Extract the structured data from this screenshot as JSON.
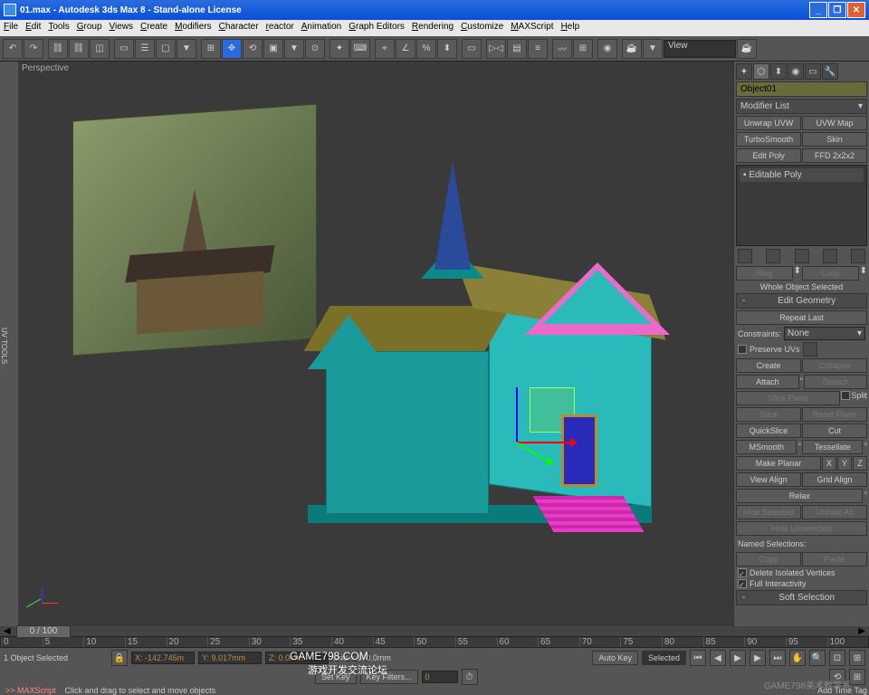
{
  "window": {
    "title": "01.max - Autodesk 3ds Max 8 - Stand-alone License"
  },
  "menu": [
    "File",
    "Edit",
    "Tools",
    "Group",
    "Views",
    "Create",
    "Modifiers",
    "Character",
    "reactor",
    "Animation",
    "Graph Editors",
    "Rendering",
    "Customize",
    "MAXScript",
    "Help"
  ],
  "toolbar": {
    "view_label": "View"
  },
  "leftstrip": {
    "label": "UV TOOLS"
  },
  "viewport": {
    "label": "Perspective"
  },
  "panel": {
    "object_name": "Object01",
    "modifier_list": "Modifier List",
    "mod_buttons": [
      [
        "Unwrap UVW",
        "UVW Map"
      ],
      [
        "TurboSmooth",
        "Skin"
      ],
      [
        "Edit Poly",
        "FFD 2x2x2"
      ]
    ],
    "stack_item": "Editable Poly",
    "ring": "Ring",
    "loop": "Loop",
    "selection_status": "Whole Object Selected",
    "edit_geometry": "Edit Geometry",
    "repeat_last": "Repeat Last",
    "constraints_lbl": "Constraints:",
    "constraints_val": "None",
    "preserve_uvs": "Preserve UVs",
    "create": "Create",
    "collapse": "Collapse",
    "attach": "Attach",
    "detach": "Detach",
    "slice_plane": "Slice Plane",
    "split": "Split",
    "slice": "Slice",
    "reset_plane": "Reset Plane",
    "quickslice": "QuickSlice",
    "cut": "Cut",
    "msmooth": "MSmooth",
    "tessellate": "Tessellate",
    "make_planar": "Make Planar",
    "x": "X",
    "y": "Y",
    "z": "Z",
    "view_align": "View Align",
    "grid_align": "Grid Align",
    "relax": "Relax",
    "hide_sel": "Hide Selected",
    "unhide": "Unhide All",
    "hide_unsel": "Hide Unselected",
    "named_sel": "Named Selections:",
    "copy": "Copy",
    "paste": "Paste",
    "del_iso": "Delete Isolated Vertices",
    "full_int": "Full Interactivity",
    "soft_sel": "Soft Selection"
  },
  "bottom": {
    "frame": "0 / 100",
    "ticks": [
      "0",
      "5",
      "10",
      "15",
      "20",
      "25",
      "30",
      "35",
      "40",
      "45",
      "50",
      "55",
      "60",
      "65",
      "70",
      "75",
      "80",
      "85",
      "90",
      "95",
      "100"
    ],
    "status1": "1 Object Selected",
    "coord_x": "X: -142.745m",
    "coord_y": "Y: 9.017mm",
    "coord_z": "Z: 0.0mm",
    "grid": "Grid = 100.0mm",
    "auto_key": "Auto Key",
    "selected": "Selected",
    "set_key": "Set Key",
    "key_filters": "Key Filters...",
    "maxscript": ">> MAXScript",
    "prompt": "Click and drag to select and move objects",
    "timetag": "Add Time Tag"
  },
  "watermark": {
    "game798": "GAME798.COM",
    "forum": "游戏开发交流论坛",
    "teach": "GAME798美术教学系"
  }
}
